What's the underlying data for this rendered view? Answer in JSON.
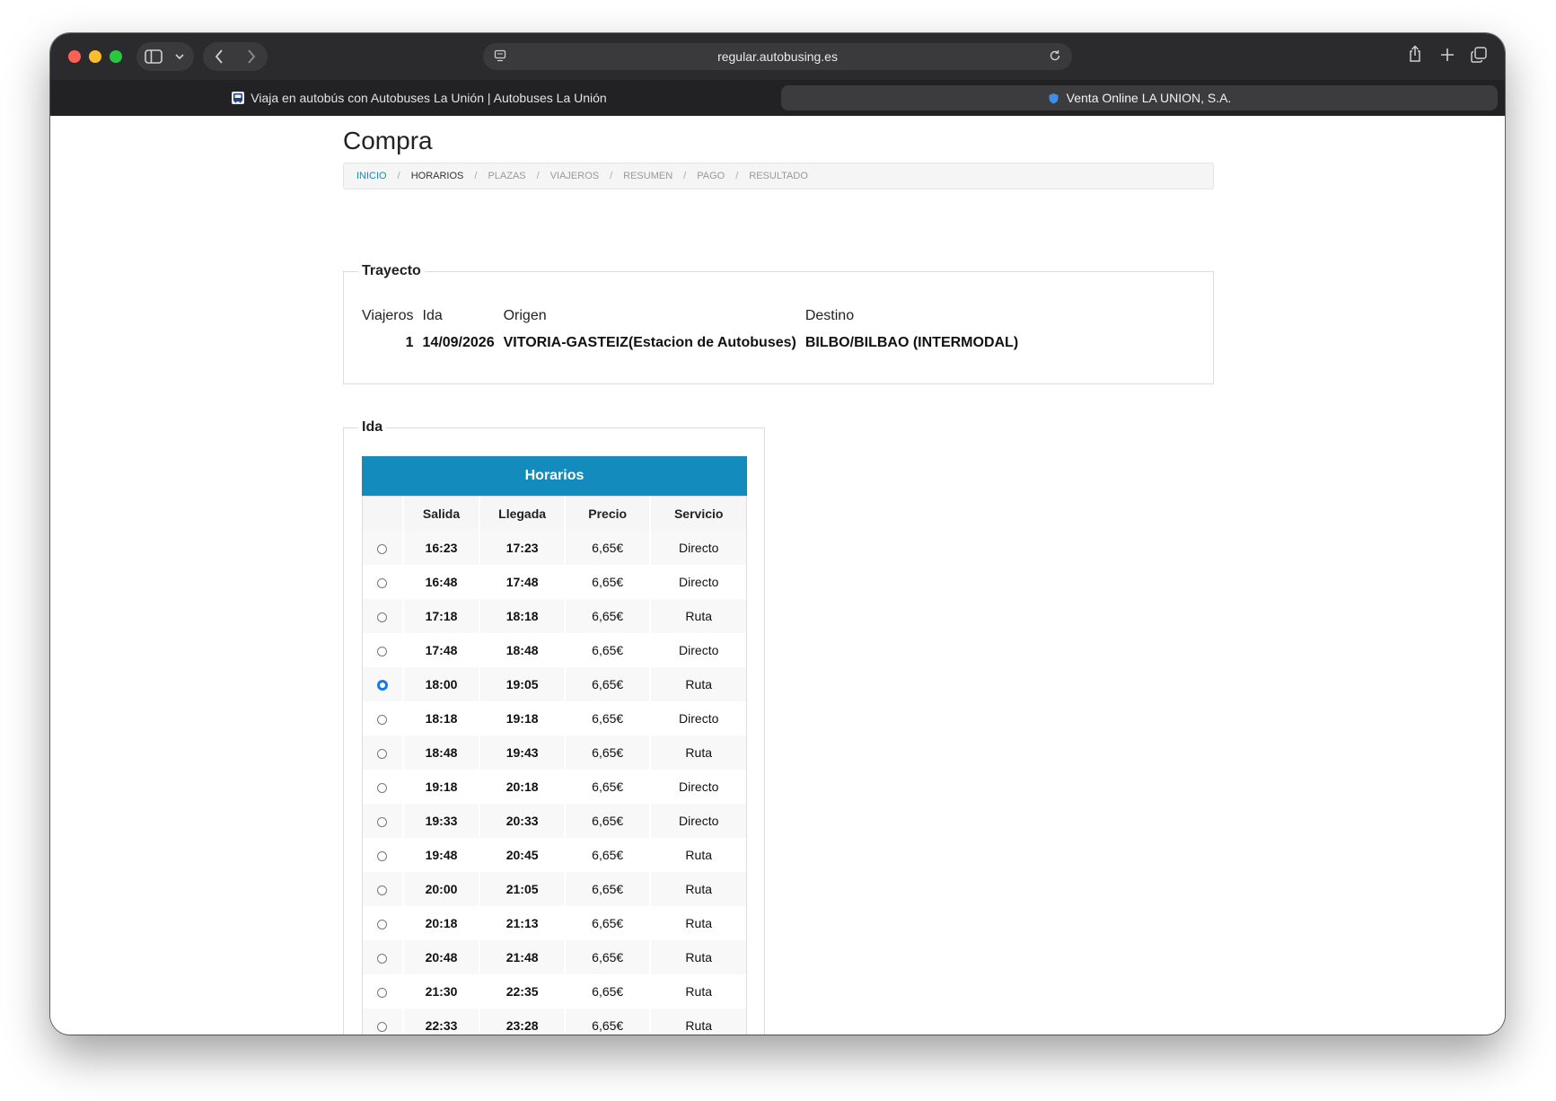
{
  "browser": {
    "url": "regular.autobusing.es",
    "tabs": [
      {
        "title": "Viaja en autobús con Autobuses La Unión | Autobuses La Unión",
        "active": false
      },
      {
        "title": "Venta Online LA UNION, S.A.",
        "active": true
      }
    ]
  },
  "page": {
    "title": "Compra",
    "breadcrumb": [
      "INICIO",
      "HORARIOS",
      "PLAZAS",
      "VIAJEROS",
      "RESUMEN",
      "PAGO",
      "RESULTADO"
    ],
    "breadcrumb_sep": "/"
  },
  "trayecto": {
    "legend": "Trayecto",
    "headers": {
      "viajeros": "Viajeros",
      "ida": "Ida",
      "origen": "Origen",
      "destino": "Destino"
    },
    "values": {
      "viajeros": "1",
      "ida": "14/09/2026",
      "origen": "VITORIA-GASTEIZ(Estacion de Autobuses)",
      "destino": "BILBO/BILBAO (INTERMODAL)"
    }
  },
  "ida": {
    "legend": "Ida",
    "table_title": "Horarios",
    "columns": [
      "",
      "Salida",
      "Llegada",
      "Precio",
      "Servicio"
    ],
    "selected_index": 4,
    "rows": [
      {
        "salida": "16:23",
        "llegada": "17:23",
        "precio": "6,65€",
        "servicio": "Directo"
      },
      {
        "salida": "16:48",
        "llegada": "17:48",
        "precio": "6,65€",
        "servicio": "Directo"
      },
      {
        "salida": "17:18",
        "llegada": "18:18",
        "precio": "6,65€",
        "servicio": "Ruta"
      },
      {
        "salida": "17:48",
        "llegada": "18:48",
        "precio": "6,65€",
        "servicio": "Directo"
      },
      {
        "salida": "18:00",
        "llegada": "19:05",
        "precio": "6,65€",
        "servicio": "Ruta"
      },
      {
        "salida": "18:18",
        "llegada": "19:18",
        "precio": "6,65€",
        "servicio": "Directo"
      },
      {
        "salida": "18:48",
        "llegada": "19:43",
        "precio": "6,65€",
        "servicio": "Ruta"
      },
      {
        "salida": "19:18",
        "llegada": "20:18",
        "precio": "6,65€",
        "servicio": "Directo"
      },
      {
        "salida": "19:33",
        "llegada": "20:33",
        "precio": "6,65€",
        "servicio": "Directo"
      },
      {
        "salida": "19:48",
        "llegada": "20:45",
        "precio": "6,65€",
        "servicio": "Ruta"
      },
      {
        "salida": "20:00",
        "llegada": "21:05",
        "precio": "6,65€",
        "servicio": "Ruta"
      },
      {
        "salida": "20:18",
        "llegada": "21:13",
        "precio": "6,65€",
        "servicio": "Ruta"
      },
      {
        "salida": "20:48",
        "llegada": "21:48",
        "precio": "6,65€",
        "servicio": "Ruta"
      },
      {
        "salida": "21:30",
        "llegada": "22:35",
        "precio": "6,65€",
        "servicio": "Ruta"
      },
      {
        "salida": "22:33",
        "llegada": "23:28",
        "precio": "6,65€",
        "servicio": "Ruta"
      }
    ]
  },
  "colors": {
    "table_header": "#138bbd",
    "breadcrumb_active": "#1a8ab8",
    "radio_selected": "#1677f2"
  },
  "icons": [
    "sidebar-icon",
    "chevron-down-icon",
    "back-arrow-icon",
    "forward-arrow-icon",
    "page-icon",
    "reload-icon",
    "share-icon",
    "plus-icon",
    "tabs-overview-icon",
    "bus-favicon",
    "shield-favicon"
  ]
}
